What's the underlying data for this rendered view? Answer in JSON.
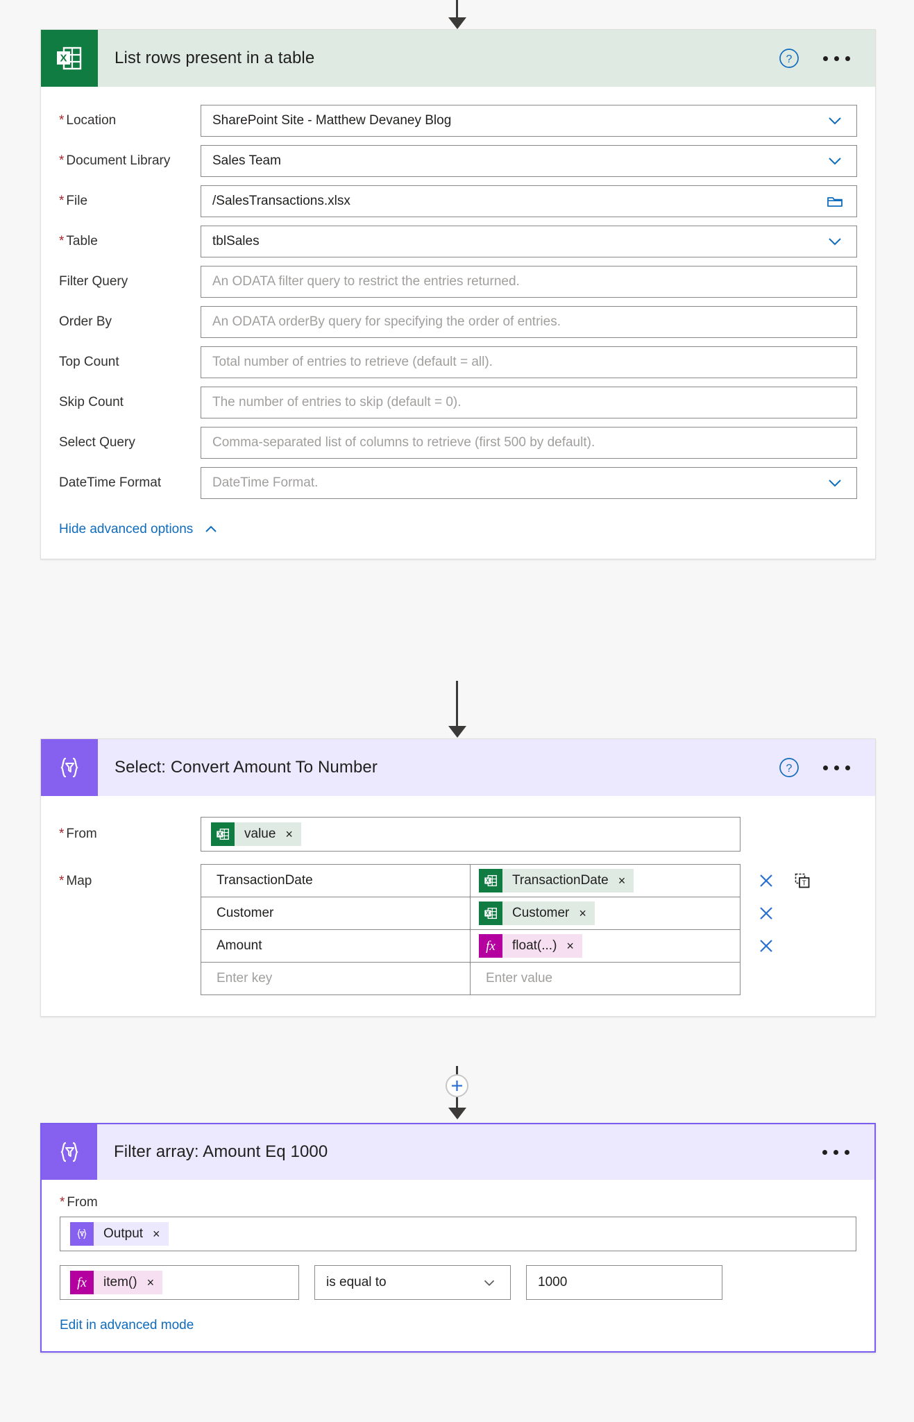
{
  "flow": {
    "connector_top": {
      "name": "arrow-down"
    },
    "add_step_button": {
      "name": "add-step-plus",
      "label": "+"
    }
  },
  "card_excel": {
    "icon": "excel-icon",
    "title": "List rows present in a table",
    "help_icon": "help-circle-icon",
    "more_icon": "more-options-icon",
    "fields": [
      {
        "label": "Location",
        "required": true,
        "value": "SharePoint Site - Matthew Devaney Blog",
        "placeholder": "",
        "control": "dropdown"
      },
      {
        "label": "Document Library",
        "required": true,
        "value": "Sales Team",
        "placeholder": "",
        "control": "dropdown"
      },
      {
        "label": "File",
        "required": true,
        "value": "/SalesTransactions.xlsx",
        "placeholder": "",
        "control": "filepicker"
      },
      {
        "label": "Table",
        "required": true,
        "value": "tblSales",
        "placeholder": "",
        "control": "dropdown"
      },
      {
        "label": "Filter Query",
        "required": false,
        "value": "",
        "placeholder": "An ODATA filter query to restrict the entries returned.",
        "control": "text"
      },
      {
        "label": "Order By",
        "required": false,
        "value": "",
        "placeholder": "An ODATA orderBy query for specifying the order of entries.",
        "control": "text"
      },
      {
        "label": "Top Count",
        "required": false,
        "value": "",
        "placeholder": "Total number of entries to retrieve (default = all).",
        "control": "text"
      },
      {
        "label": "Skip Count",
        "required": false,
        "value": "",
        "placeholder": "The number of entries to skip (default = 0).",
        "control": "text"
      },
      {
        "label": "Select Query",
        "required": false,
        "value": "",
        "placeholder": "Comma-separated list of columns to retrieve (first 500 by default).",
        "control": "text"
      },
      {
        "label": "DateTime Format",
        "required": false,
        "value": "",
        "placeholder": "DateTime Format.",
        "control": "dropdown"
      }
    ],
    "advanced_link": "Hide advanced options",
    "advanced_caret": "chevron-up-icon"
  },
  "card_select": {
    "icon": "select-action-icon",
    "title": "Select: Convert Amount To Number",
    "help_icon": "help-circle-icon",
    "more_icon": "more-options-icon",
    "from_label": "From",
    "from_token": {
      "text": "value",
      "icon": "excel-icon",
      "style": "green",
      "remove": "×"
    },
    "map_label": "Map",
    "map_rows": [
      {
        "key": "TransactionDate",
        "value_token": {
          "text": "TransactionDate",
          "icon": "excel-icon",
          "style": "green",
          "remove": "×"
        },
        "key_placeholder": "",
        "value_placeholder": ""
      },
      {
        "key": "Customer",
        "value_token": {
          "text": "Customer",
          "icon": "excel-icon",
          "style": "green",
          "remove": "×"
        },
        "key_placeholder": "",
        "value_placeholder": ""
      },
      {
        "key": "Amount",
        "value_token": {
          "text": "float(...)",
          "icon": "fx-icon",
          "style": "pink",
          "remove": "×"
        },
        "key_placeholder": "",
        "value_placeholder": ""
      },
      {
        "key": "",
        "value_token": null,
        "key_placeholder": "Enter key",
        "value_placeholder": "Enter value"
      }
    ],
    "delete_icon": "delete-x-icon",
    "textmode_icon": "switch-to-text-mode-icon"
  },
  "card_filter": {
    "icon": "filter-array-icon",
    "title": "Filter array: Amount Eq 1000",
    "more_icon": "more-options-icon",
    "from_label": "From",
    "from_token": {
      "text": "Output",
      "icon": "select-action-icon",
      "style": "violet",
      "remove": "×"
    },
    "condition": {
      "left_token": {
        "text": "item()",
        "icon": "fx-icon",
        "style": "pink",
        "remove": "×"
      },
      "operator": "is equal to",
      "operator_caret": "chevron-down-icon",
      "value": "1000"
    },
    "advanced_link": "Edit in advanced mode"
  },
  "colors": {
    "excel_green": "#107c41",
    "excel_header": "#dfeae2",
    "purple": "#8661f0",
    "purple_header": "#ece8fd",
    "fx_magenta": "#b4009e",
    "link_blue": "#0f6cbd",
    "required_red": "#a4262c",
    "selected_border": "#7a5cf0"
  }
}
